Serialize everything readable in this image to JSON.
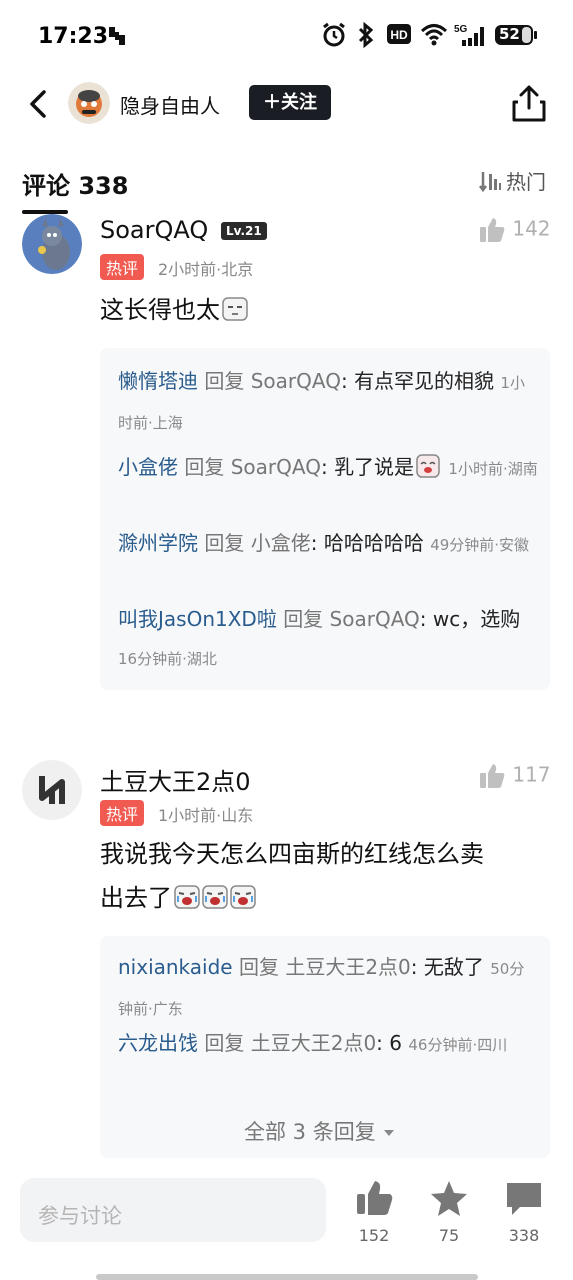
{
  "status_bar": {
    "time": "17:23",
    "battery": "52",
    "icons": [
      "alarm-icon",
      "bluetooth-icon",
      "hd-icon",
      "wifi-icon",
      "5g-signal-icon",
      "battery-icon"
    ]
  },
  "header": {
    "author_name": "隐身自由人",
    "follow_label": "＋关注"
  },
  "comments": {
    "title": "评论 338",
    "sort_label": "热门"
  },
  "comment_1": {
    "user": "SoarQAQ",
    "level": "Lv.21",
    "tag": "热评",
    "meta": "2小时前·北京",
    "text": "这长得也太",
    "likes": "142",
    "replies": [
      {
        "user": "懒惰塔迪",
        "action": "回复",
        "target": "SoarQAQ",
        "text": "有点罕见的相貌",
        "meta": "1小时前·上海"
      },
      {
        "user": "小盒佬",
        "action": "回复",
        "target": "SoarQAQ",
        "text": "乳了说是",
        "meta": "1小时前·湖南"
      },
      {
        "user": "滁州学院",
        "action": "回复",
        "target": "小盒佬",
        "text": "哈哈哈哈哈",
        "meta": "49分钟前·安徽"
      },
      {
        "user": "叫我JasOn1XD啦",
        "action": "回复",
        "target": "SoarQAQ",
        "text": "wc，选购",
        "meta": "16分钟前·湖北"
      }
    ]
  },
  "comment_2": {
    "user": "土豆大王2点0",
    "tag": "热评",
    "meta": "1小时前·山东",
    "text_line1": "我说我今天怎么四亩斯的红线怎么卖",
    "text_line2": "出去了",
    "likes": "117",
    "replies": [
      {
        "user": "nixiankaide",
        "action": "回复",
        "target": "土豆大王2点0",
        "text": "无敌了",
        "meta": "50分钟前·广东"
      },
      {
        "user": "六龙出饯",
        "action": "回复",
        "target": "土豆大王2点0",
        "text": "6",
        "meta": "46分钟前·四川"
      }
    ],
    "more_replies": "全部 3 条回复"
  },
  "bottom_bar": {
    "input_placeholder": "参与讨论",
    "like_count": "152",
    "favorite_count": "75",
    "comment_count": "338"
  }
}
